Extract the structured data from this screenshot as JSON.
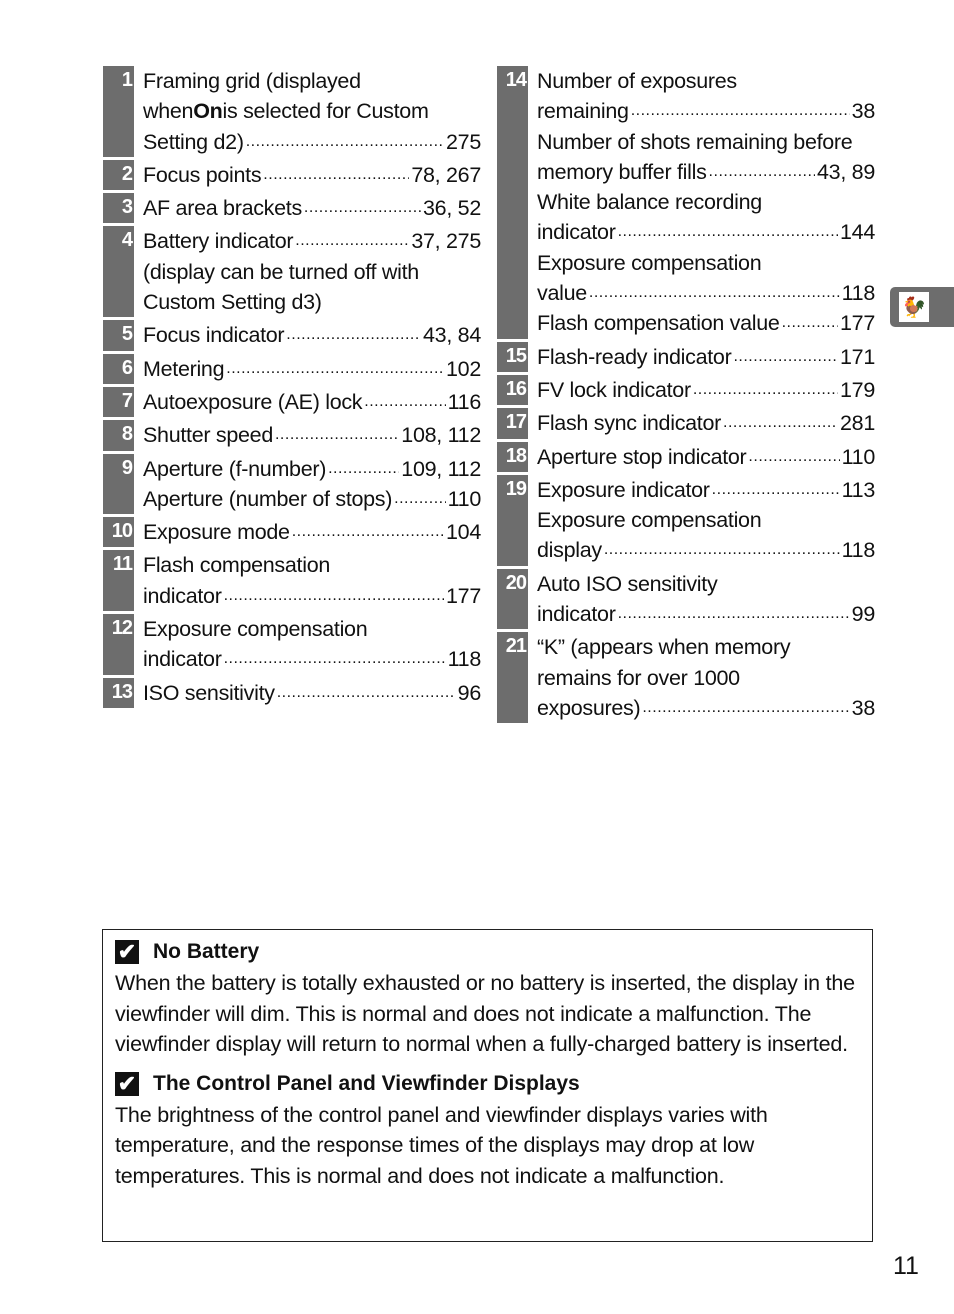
{
  "left_entries": [
    {
      "num": "1",
      "lines": [
        {
          "text": "Framing grid (displayed"
        },
        {
          "text": "when ",
          "bold": "On",
          "post": " is selected for Custom"
        },
        {
          "text": "Setting d2)",
          "page": "275"
        }
      ]
    },
    {
      "num": "2",
      "lines": [
        {
          "text": "Focus points",
          "page": "78, 267"
        }
      ]
    },
    {
      "num": "3",
      "lines": [
        {
          "text": "AF area brackets",
          "page": "36, 52"
        }
      ]
    },
    {
      "num": "4",
      "lines": [
        {
          "text": "Battery indicator",
          "page": "37, 275"
        },
        {
          "text": "(display can be turned off with"
        },
        {
          "text": "Custom Setting d3)"
        }
      ]
    },
    {
      "num": "5",
      "lines": [
        {
          "text": "Focus indicator",
          "page": "43, 84"
        }
      ]
    },
    {
      "num": "6",
      "lines": [
        {
          "text": "Metering",
          "page": "102"
        }
      ]
    },
    {
      "num": "7",
      "lines": [
        {
          "text": "Autoexposure (AE) lock",
          "page": "116"
        }
      ]
    },
    {
      "num": "8",
      "lines": [
        {
          "text": "Shutter speed",
          "page": "108, 112"
        }
      ]
    },
    {
      "num": "9",
      "lines": [
        {
          "text": "Aperture (f-number)",
          "page": "109, 112"
        },
        {
          "text": "Aperture (number of stops)",
          "page": "110"
        }
      ]
    },
    {
      "num": "10",
      "lines": [
        {
          "text": "Exposure mode",
          "page": "104"
        }
      ]
    },
    {
      "num": "11",
      "lines": [
        {
          "text": "Flash compensation"
        },
        {
          "text": "indicator",
          "page": "177"
        }
      ]
    },
    {
      "num": "12",
      "lines": [
        {
          "text": "Exposure compensation"
        },
        {
          "text": "indicator",
          "page": "118"
        }
      ]
    },
    {
      "num": "13",
      "lines": [
        {
          "text": "ISO sensitivity",
          "page": "96"
        }
      ]
    }
  ],
  "right_entries": [
    {
      "num": "14",
      "lines": [
        {
          "text": "Number of exposures"
        },
        {
          "text": "remaining",
          "page": "38"
        },
        {
          "text": "Number of shots remaining before"
        },
        {
          "text": "memory buffer fills",
          "page": "43, 89"
        },
        {
          "text": "White balance recording"
        },
        {
          "text": "indicator",
          "page": "144"
        },
        {
          "text": "Exposure compensation"
        },
        {
          "text": "value",
          "page": "118"
        },
        {
          "text": "Flash compensation value",
          "page": "177"
        }
      ]
    },
    {
      "num": "15",
      "lines": [
        {
          "text": "Flash-ready indicator",
          "page": "171"
        }
      ]
    },
    {
      "num": "16",
      "lines": [
        {
          "text": "FV lock indicator",
          "page": "179"
        }
      ]
    },
    {
      "num": "17",
      "lines": [
        {
          "text": "Flash sync indicator",
          "page": "281"
        }
      ]
    },
    {
      "num": "18",
      "lines": [
        {
          "text": "Aperture stop indicator",
          "page": "110"
        }
      ]
    },
    {
      "num": "19",
      "lines": [
        {
          "text": "Exposure indicator",
          "page": "113"
        },
        {
          "text": "Exposure compensation"
        },
        {
          "text": "display",
          "page": "118"
        }
      ]
    },
    {
      "num": "20",
      "lines": [
        {
          "text": "Auto ISO sensitivity"
        },
        {
          "text": "indicator",
          "page": "99"
        }
      ]
    },
    {
      "num": "21",
      "lines": [
        {
          "text": "“K” (appears when memory"
        },
        {
          "text": "remains for over 1000"
        },
        {
          "text": "exposures)",
          "page": "38"
        }
      ]
    }
  ],
  "side_tab": {
    "icon": "rooster-weathervane-icon"
  },
  "notes": [
    {
      "icon": "checkmark-icon",
      "title": "No Battery",
      "body": "When the battery is totally exhausted or no battery is inserted, the display in the viewfinder will dim.  This is normal and does not indicate a malfunction.  The viewfinder display will return to normal when a fully-charged battery is inserted."
    },
    {
      "icon": "checkmark-icon",
      "title": "The Control Panel and Viewfinder Displays",
      "body": "The brightness of the control panel and viewfinder displays varies with temperature, and the response times of the displays may drop at low temperatures.  This is normal and does not indicate a malfunction."
    }
  ],
  "page_number": "11",
  "colors": {
    "number_box": "#6d6d6d",
    "text": "#111111"
  }
}
